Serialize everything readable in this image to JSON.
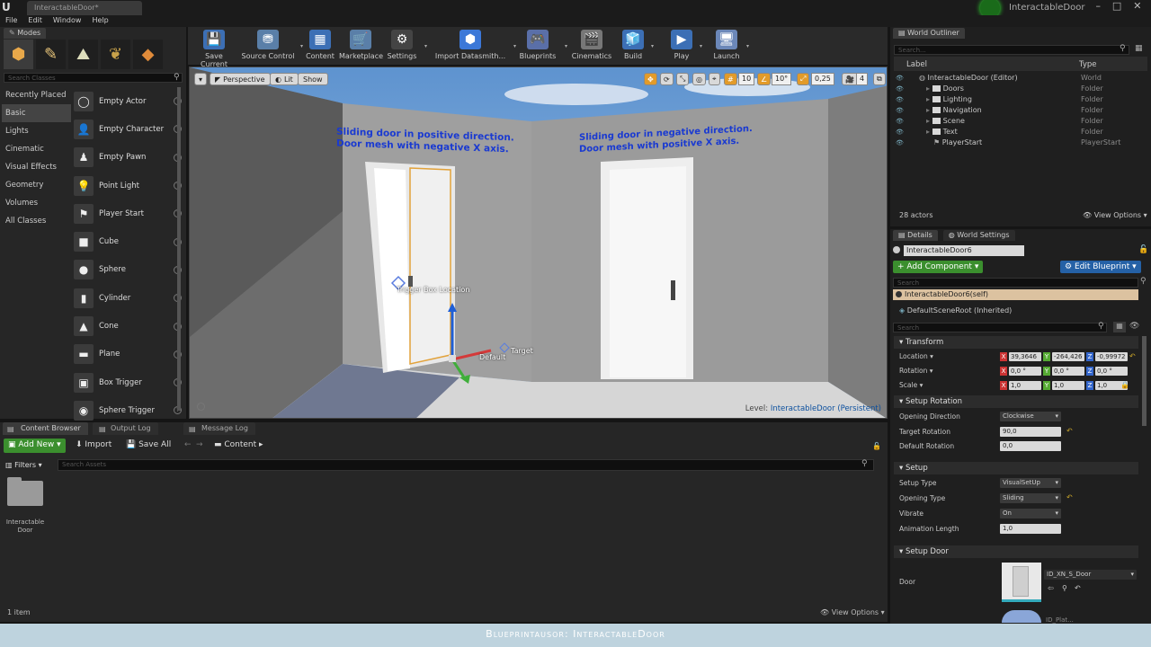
{
  "window": {
    "tab_title": "InteractableDoor*",
    "project_name": "InteractableDoor",
    "controls": [
      "–",
      "□",
      "✕"
    ]
  },
  "menu": [
    "File",
    "Edit",
    "Window",
    "Help"
  ],
  "modes": {
    "tab": "Modes",
    "search_placeholder": "Search Classes",
    "categories": [
      "Recently Placed",
      "Basic",
      "Lights",
      "Cinematic",
      "Visual Effects",
      "Geometry",
      "Volumes",
      "All Classes"
    ],
    "selected_category": "Basic",
    "items": [
      {
        "label": "Empty Actor",
        "icon": "◯"
      },
      {
        "label": "Empty Character",
        "icon": "👤"
      },
      {
        "label": "Empty Pawn",
        "icon": "♟"
      },
      {
        "label": "Point Light",
        "icon": "💡"
      },
      {
        "label": "Player Start",
        "icon": "⚑"
      },
      {
        "label": "Cube",
        "icon": "■"
      },
      {
        "label": "Sphere",
        "icon": "●"
      },
      {
        "label": "Cylinder",
        "icon": "▮"
      },
      {
        "label": "Cone",
        "icon": "▲"
      },
      {
        "label": "Plane",
        "icon": "▬"
      },
      {
        "label": "Box Trigger",
        "icon": "▣"
      },
      {
        "label": "Sphere Trigger",
        "icon": "◉"
      }
    ]
  },
  "toolbar": {
    "items": [
      {
        "label": "Save Current",
        "icon": "💾"
      },
      {
        "label": "Source Control",
        "icon": "⛃"
      },
      {
        "label": "Content",
        "icon": "▦"
      },
      {
        "label": "Marketplace",
        "icon": "🛒"
      },
      {
        "label": "Settings",
        "icon": "⚙"
      },
      {
        "label": "Import Datasmith...",
        "icon": "⬢"
      },
      {
        "label": "Blueprints",
        "icon": "🎮"
      },
      {
        "label": "Cinematics",
        "icon": "🎬"
      },
      {
        "label": "Build",
        "icon": "🧊"
      },
      {
        "label": "Play",
        "icon": "▶"
      },
      {
        "label": "Launch",
        "icon": "🖥"
      }
    ]
  },
  "viewport": {
    "perspective": "Perspective",
    "lit": "Lit",
    "show": "Show",
    "grid_snap": "10",
    "rot_snap": "10°",
    "scale_snap": "0,25",
    "camera_speed": "4",
    "text_left": [
      "Sliding door in positive direction.",
      "Door mesh with negative X axis."
    ],
    "text_right": [
      "Sliding door in negative direction.",
      "Door mesh with positive X axis."
    ],
    "trigger_label": "Trigger Box Location",
    "target_label": "Target",
    "default_label": "Default",
    "level_prefix": "Level:",
    "level_name": "InteractableDoor (Persistent)"
  },
  "outliner": {
    "tab": "World Outliner",
    "search_placeholder": "Search...",
    "col_label": "Label",
    "col_type": "Type",
    "rows": [
      {
        "label": "InteractableDoor (Editor)",
        "type": "World"
      },
      {
        "label": "Doors",
        "type": "Folder"
      },
      {
        "label": "Lighting",
        "type": "Folder"
      },
      {
        "label": "Navigation",
        "type": "Folder"
      },
      {
        "label": "Scene",
        "type": "Folder"
      },
      {
        "label": "Text",
        "type": "Folder"
      },
      {
        "label": "PlayerStart",
        "type": "PlayerStart"
      }
    ],
    "actor_count": "28 actors",
    "view_options": "View Options"
  },
  "details": {
    "tab_details": "Details",
    "tab_world": "World Settings",
    "object_name": "InteractableDoor6",
    "add_component": "+ Add Component",
    "edit_blueprint": "Edit Blueprint",
    "search_placeholder": "Search",
    "self_row": "InteractableDoor6(self)",
    "root_row": "DefaultSceneRoot (Inherited)",
    "search2_placeholder": "Search",
    "transform": {
      "header": "Transform",
      "location_label": "Location",
      "rotation_label": "Rotation",
      "scale_label": "Scale",
      "location": [
        "39,3646",
        "-264,426",
        "-0,99972"
      ],
      "rotation": [
        "0,0 °",
        "0,0 °",
        "0,0 °"
      ],
      "scale": [
        "1,0",
        "1,0",
        "1,0"
      ]
    },
    "setup_rotation": {
      "header": "Setup Rotation",
      "opening_direction_label": "Opening Direction",
      "opening_direction": "Clockwise",
      "target_rotation_label": "Target Rotation",
      "target_rotation": "90,0",
      "default_rotation_label": "Default Rotation",
      "default_rotation": "0,0"
    },
    "setup": {
      "header": "Setup",
      "setup_type_label": "Setup Type",
      "setup_type": "VisualSetUp",
      "opening_type_label": "Opening Type",
      "opening_type": "Sliding",
      "vibrate_label": "Vibrate",
      "vibrate": "On",
      "anim_length_label": "Animation Length",
      "anim_length": "1,0"
    },
    "setup_door": {
      "header": "Setup Door",
      "door_label": "Door",
      "door_asset": "ID_XN_S_Door",
      "next_asset": "ID_Plat..."
    }
  },
  "content_browser": {
    "tabs": [
      "Content Browser",
      "Output Log",
      "Message Log"
    ],
    "add_new": "Add New",
    "import": "Import",
    "save_all": "Save All",
    "path": "Content",
    "filters": "Filters",
    "search_placeholder": "Search Assets",
    "asset_name": "Interactable Door",
    "item_count": "1 item",
    "view_options": "View Options"
  },
  "status": {
    "text": "Blueprintausor: InteractableDoor"
  }
}
